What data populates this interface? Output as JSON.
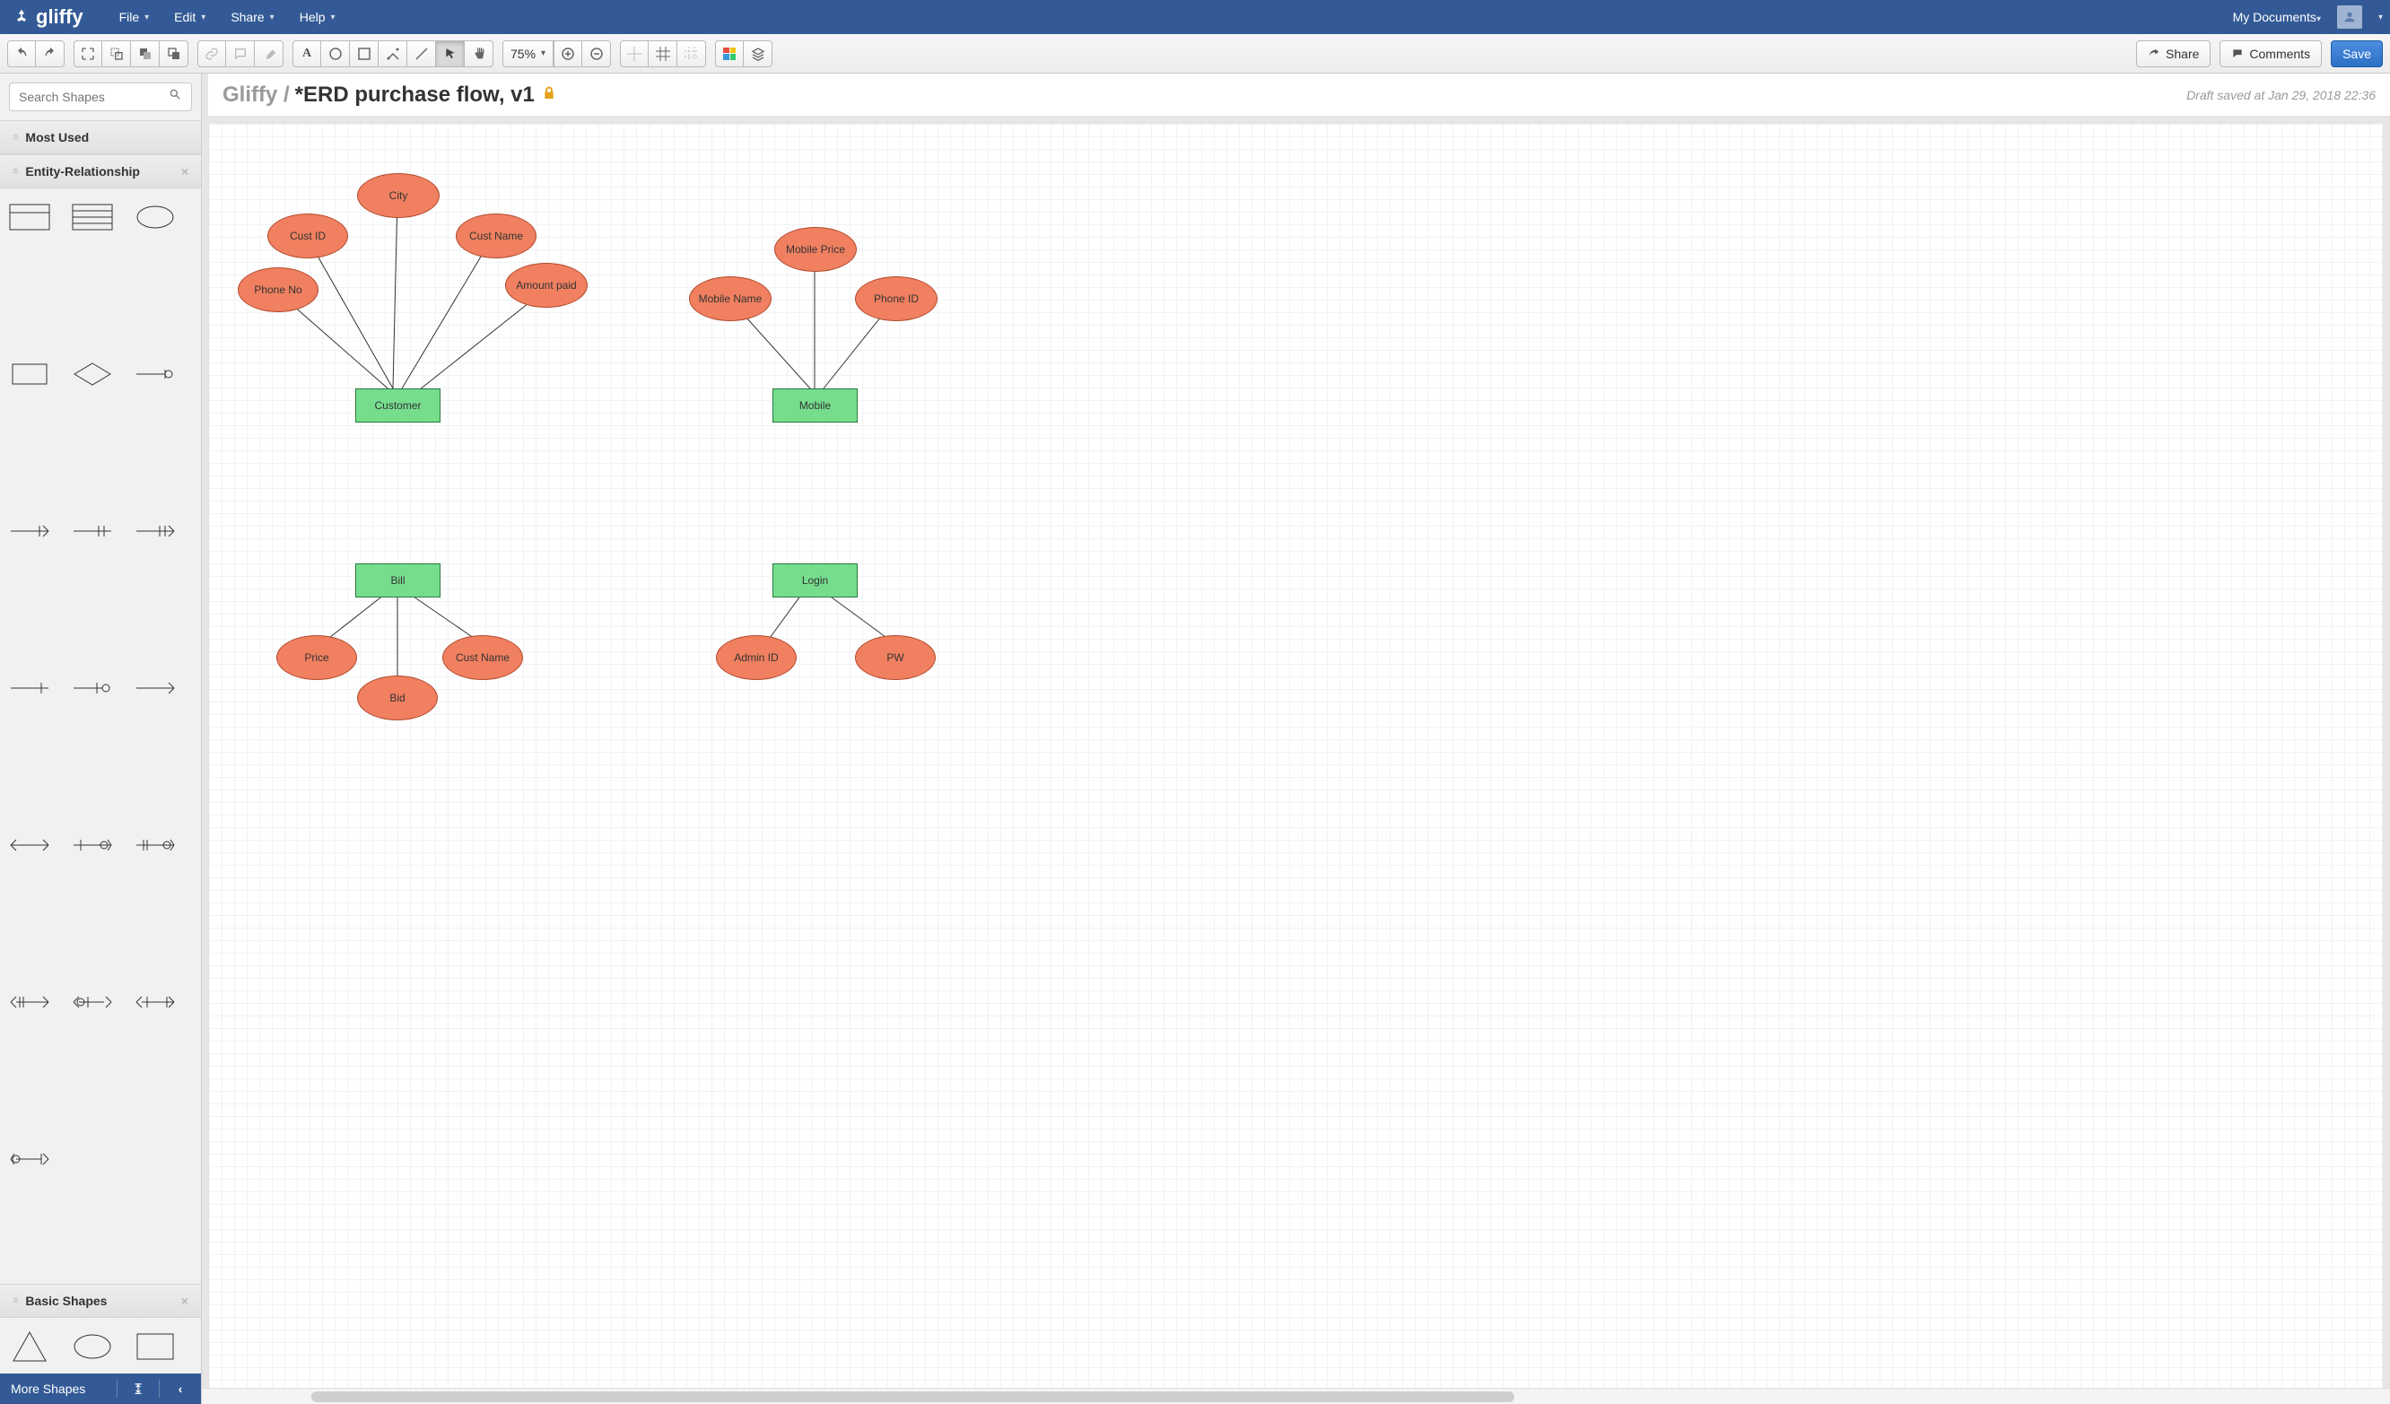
{
  "brand": "gliffy",
  "menu": {
    "file": "File",
    "edit": "Edit",
    "share": "Share",
    "help": "Help",
    "mydocs": "My Documents"
  },
  "toolbar": {
    "zoom": "75%",
    "share_label": "Share",
    "comments_label": "Comments",
    "save_label": "Save"
  },
  "sidebar": {
    "search_placeholder": "Search Shapes",
    "sections": {
      "most_used": "Most Used",
      "er": "Entity-Relationship",
      "basic": "Basic Shapes"
    },
    "footer": "More Shapes"
  },
  "doc": {
    "crumb": "Gliffy /",
    "title": "*ERD purchase flow, v1",
    "status": "Draft saved at Jan 29, 2018 22:36"
  },
  "diagram": {
    "entities": {
      "customer": "Customer",
      "mobile": "Mobile",
      "bill": "Bill",
      "login": "Login"
    },
    "attributes": {
      "phone_no": "Phone No",
      "cust_id": "Cust ID",
      "city": "City",
      "cust_name": "Cust Name",
      "amount_paid": "Amount paid",
      "mobile_name": "Mobile Name",
      "mobile_price": "Mobile Price",
      "phone_id": "Phone ID",
      "price": "Price",
      "bid": "Bid",
      "cust_name2": "Cust Name",
      "admin_id": "Admin ID",
      "pw": "PW"
    }
  }
}
